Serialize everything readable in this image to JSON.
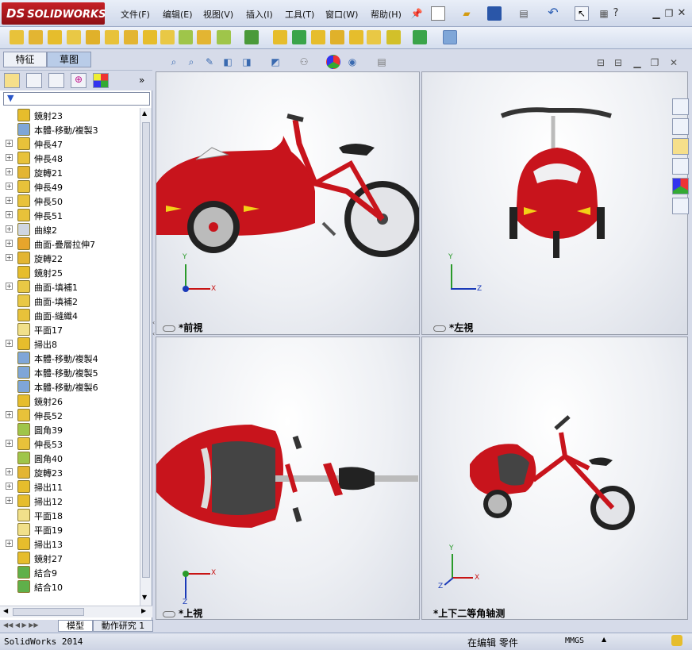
{
  "app": {
    "brand": "SOLIDWORKS",
    "brand_prefix": "DS"
  },
  "menu": [
    "文件(F)",
    "编辑(E)",
    "视图(V)",
    "插入(I)",
    "工具(T)",
    "窗口(W)",
    "帮助(H)"
  ],
  "tabs": {
    "feature": "特征",
    "sketch": "草图"
  },
  "tree": [
    {
      "label": "鏡射23",
      "icon": "mirror",
      "exp": false
    },
    {
      "label": "本體-移動/複製3",
      "icon": "move",
      "exp": false
    },
    {
      "label": "伸長47",
      "icon": "extrude",
      "exp": true
    },
    {
      "label": "伸長48",
      "icon": "extrude",
      "exp": true
    },
    {
      "label": "旋轉21",
      "icon": "revolve",
      "exp": true
    },
    {
      "label": "伸長49",
      "icon": "extrude",
      "exp": true
    },
    {
      "label": "伸長50",
      "icon": "extrude",
      "exp": true
    },
    {
      "label": "伸長51",
      "icon": "extrude",
      "exp": true
    },
    {
      "label": "曲線2",
      "icon": "curve",
      "exp": true
    },
    {
      "label": "曲面-疊層拉伸7",
      "icon": "loft",
      "exp": true
    },
    {
      "label": "旋轉22",
      "icon": "revolve",
      "exp": true
    },
    {
      "label": "鏡射25",
      "icon": "mirror",
      "exp": false
    },
    {
      "label": "曲面-填補1",
      "icon": "fill",
      "exp": true
    },
    {
      "label": "曲面-填補2",
      "icon": "fill",
      "exp": false
    },
    {
      "label": "曲面-縫織4",
      "icon": "knit",
      "exp": false
    },
    {
      "label": "平面17",
      "icon": "plane",
      "exp": false
    },
    {
      "label": "掃出8",
      "icon": "sweep",
      "exp": true
    },
    {
      "label": "本體-移動/複製4",
      "icon": "move",
      "exp": false
    },
    {
      "label": "本體-移動/複製5",
      "icon": "move",
      "exp": false
    },
    {
      "label": "本體-移動/複製6",
      "icon": "move",
      "exp": false
    },
    {
      "label": "鏡射26",
      "icon": "mirror",
      "exp": false
    },
    {
      "label": "伸長52",
      "icon": "extrude",
      "exp": true
    },
    {
      "label": "圓角39",
      "icon": "fillet",
      "exp": false
    },
    {
      "label": "伸長53",
      "icon": "extrude",
      "exp": true
    },
    {
      "label": "圓角40",
      "icon": "fillet",
      "exp": false
    },
    {
      "label": "旋轉23",
      "icon": "revolve",
      "exp": true
    },
    {
      "label": "掃出11",
      "icon": "sweep",
      "exp": true
    },
    {
      "label": "掃出12",
      "icon": "sweep",
      "exp": true
    },
    {
      "label": "平面18",
      "icon": "plane",
      "exp": false
    },
    {
      "label": "平面19",
      "icon": "plane",
      "exp": false
    },
    {
      "label": "掃出13",
      "icon": "sweep",
      "exp": true
    },
    {
      "label": "鏡射27",
      "icon": "mirror",
      "exp": false
    },
    {
      "label": "結合9",
      "icon": "combine",
      "exp": false
    },
    {
      "label": "結合10",
      "icon": "combine",
      "exp": false
    }
  ],
  "viewports": {
    "front": {
      "label": "*前視"
    },
    "left": {
      "label": "*左視"
    },
    "top": {
      "label": "*上視"
    },
    "iso": {
      "label": "*上下二等角轴测"
    }
  },
  "axes": {
    "x": "X",
    "y": "Y",
    "z": "Z"
  },
  "bottomtabs": {
    "model": "模型",
    "motion": "動作研究 1"
  },
  "status": {
    "app": "SolidWorks 2014",
    "editing": "在编辑 零件",
    "units": "MMGS"
  },
  "colors": {
    "body": "#c8141c",
    "dark": "#7a0a0e",
    "frame": "#c8141c"
  }
}
